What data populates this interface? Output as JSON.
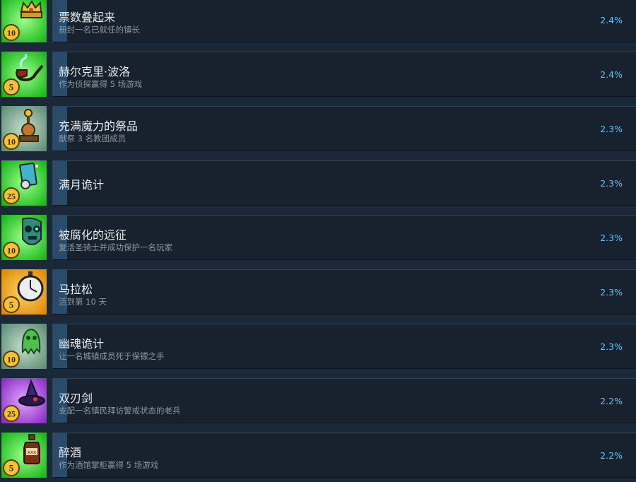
{
  "achievements": [
    {
      "title": "票数叠起来",
      "desc": "册封一名已就任的镇长",
      "percent": "2.4%",
      "badge": "10",
      "icon": "crown-icon",
      "bg": "#1fcf22"
    },
    {
      "title": "赫尔克里·波洛",
      "desc": "作为侦探赢得 5 场游戏",
      "percent": "2.4%",
      "badge": "5",
      "icon": "pipe-icon",
      "bg": "#1fcf22"
    },
    {
      "title": "充满魔力的祭品",
      "desc": "献祭 3 名教团成员",
      "percent": "2.3%",
      "badge": "10",
      "icon": "ritual-altar-icon",
      "bg": "#6f9f86"
    },
    {
      "title": "满月诡计",
      "desc": "",
      "percent": "2.3%",
      "badge": "25",
      "icon": "tarot-card-icon",
      "bg": "#1fcf22"
    },
    {
      "title": "被腐化的远征",
      "desc": "复活圣骑士并成功保护一名玩家",
      "percent": "2.3%",
      "badge": "10",
      "icon": "zombie-head-icon",
      "bg": "#1fcf22"
    },
    {
      "title": "马拉松",
      "desc": "活到第 10 天",
      "percent": "2.3%",
      "badge": "5",
      "icon": "stopwatch-icon",
      "bg": "#f0a10e"
    },
    {
      "title": "幽魂诡计",
      "desc": "让一名城镇成员死于保镖之手",
      "percent": "2.3%",
      "badge": "10",
      "icon": "ghost-icon",
      "bg": "#6f9f86"
    },
    {
      "title": "双刃剑",
      "desc": "支配一名镇民拜访警戒状态的老兵",
      "percent": "2.2%",
      "badge": "25",
      "icon": "witch-hat-icon",
      "bg": "#a443d8"
    },
    {
      "title": "醉酒",
      "desc": "作为酒馆掌柜赢得 5 场游戏",
      "percent": "2.2%",
      "badge": "5",
      "icon": "poison-bottle-icon",
      "bg": "#1fcf22"
    }
  ]
}
